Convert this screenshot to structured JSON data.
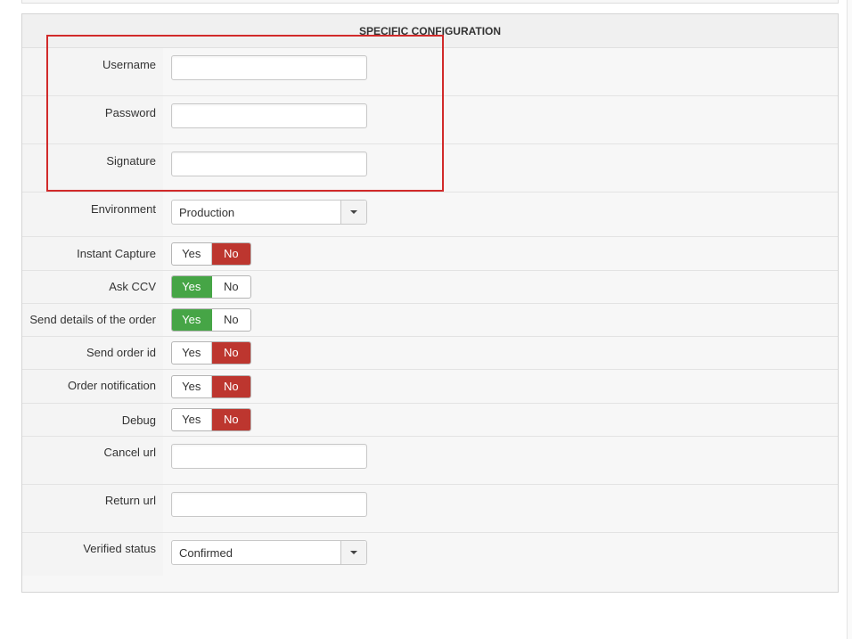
{
  "panel": {
    "title": "SPECIFIC CONFIGURATION"
  },
  "fields": {
    "username": {
      "label": "Username",
      "value": ""
    },
    "password": {
      "label": "Password",
      "value": ""
    },
    "signature": {
      "label": "Signature",
      "value": ""
    },
    "environment": {
      "label": "Environment",
      "value": "Production"
    },
    "instant_capture": {
      "label": "Instant Capture",
      "yes": "Yes",
      "no": "No",
      "selected": "No"
    },
    "ask_ccv": {
      "label": "Ask CCV",
      "yes": "Yes",
      "no": "No",
      "selected": "Yes"
    },
    "send_details": {
      "label": "Send details of the order",
      "yes": "Yes",
      "no": "No",
      "selected": "Yes"
    },
    "send_order_id": {
      "label": "Send order id",
      "yes": "Yes",
      "no": "No",
      "selected": "No"
    },
    "order_notification": {
      "label": "Order notification",
      "yes": "Yes",
      "no": "No",
      "selected": "No"
    },
    "debug": {
      "label": "Debug",
      "yes": "Yes",
      "no": "No",
      "selected": "No"
    },
    "cancel_url": {
      "label": "Cancel url",
      "value": ""
    },
    "return_url": {
      "label": "Return url",
      "value": ""
    },
    "verified_status": {
      "label": "Verified status",
      "value": "Confirmed"
    }
  },
  "colors": {
    "toggle_yes_active": "#46a546",
    "toggle_no_active": "#bd362f",
    "highlight_box": "#d12a2a"
  }
}
